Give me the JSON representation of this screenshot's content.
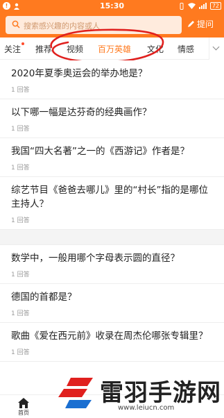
{
  "status_bar": {
    "time": "15:30",
    "battery": "72"
  },
  "search": {
    "placeholder": "搜索感兴趣的内容或人",
    "ask_label": "提问"
  },
  "tabs": [
    {
      "label": "关注",
      "has_dot": true
    },
    {
      "label": "推荐"
    },
    {
      "label": "视频"
    },
    {
      "label": "百万英雄",
      "active": true
    },
    {
      "label": "文化"
    },
    {
      "label": "情感"
    }
  ],
  "questions": [
    {
      "title": "2020年夏季奥运会的举办地是？",
      "meta": "1 回答"
    },
    {
      "title": "以下哪一幅是达芬奇的经典画作？",
      "meta": "1 回答"
    },
    {
      "title": "我国“四大名著”之一的《西游记》作者是？",
      "meta": "1 回答"
    },
    {
      "title": "综艺节目《爸爸去哪儿》里的“村长”指的是哪位主持人？",
      "meta": "1 回答"
    },
    {
      "title": "数学中，一般用哪个字母表示圆的直径？",
      "meta": "1 回答"
    },
    {
      "title": "德国的首都是？",
      "meta": "1 回答"
    },
    {
      "title": "歌曲《爱在西元前》收录在周杰伦哪张专辑里？",
      "meta": "1 回答"
    }
  ],
  "bottom_nav": {
    "home_label": "首页"
  },
  "watermark": {
    "name": "雷羽手游网",
    "url": "www.leiucn.com"
  },
  "colors": {
    "accent": "#ff7a1f",
    "annotation": "#e0201e"
  }
}
